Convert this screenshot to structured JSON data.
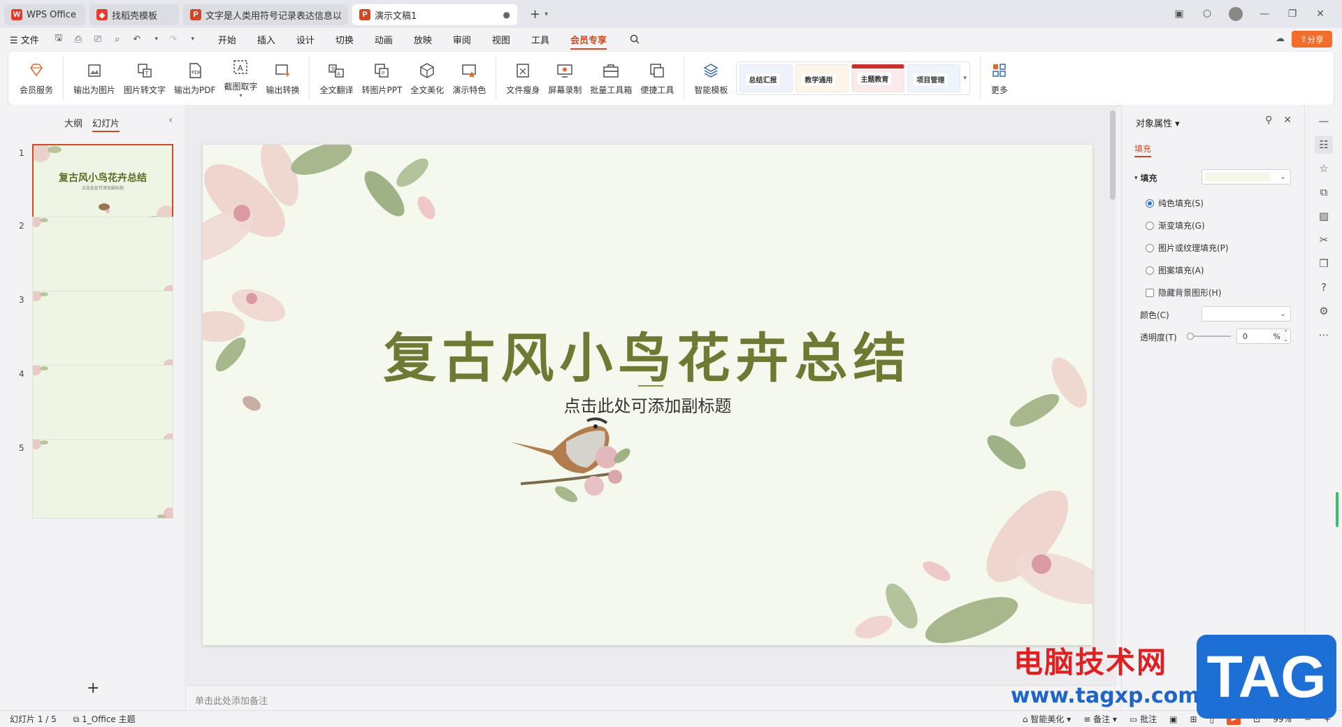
{
  "titlebar": {
    "tabs": [
      {
        "label": "WPS Office",
        "icon": "wps-logo-icon",
        "color": "#e33b2e"
      },
      {
        "label": "找稻壳模板",
        "icon": "docer-icon",
        "color": "#e33b2e"
      },
      {
        "label": "文字是人类用符号记录表达信息以传",
        "icon": "ppt-icon",
        "color": "#d24726"
      },
      {
        "label": "演示文稿1",
        "icon": "ppt-icon",
        "color": "#d24726",
        "active": true
      }
    ],
    "new_tab": "+"
  },
  "menubar": {
    "file_label": "文件",
    "items": [
      "开始",
      "插入",
      "设计",
      "切换",
      "动画",
      "放映",
      "审阅",
      "视图",
      "工具",
      "会员专享"
    ],
    "active_item": "会员专享",
    "share_label": "分享"
  },
  "ribbon": {
    "group1": [
      {
        "label": "会员服务"
      }
    ],
    "group2": [
      {
        "label": "输出为图片"
      },
      {
        "label": "图片转文字"
      },
      {
        "label": "输出为PDF"
      },
      {
        "label": "截图取字"
      },
      {
        "label": "输出转换"
      }
    ],
    "group3": [
      {
        "label": "全文翻译"
      },
      {
        "label": "转图片PPT"
      },
      {
        "label": "全文美化"
      },
      {
        "label": "演示特色"
      }
    ],
    "group4": [
      {
        "label": "文件瘦身"
      },
      {
        "label": "屏幕录制"
      },
      {
        "label": "批量工具箱"
      },
      {
        "label": "便捷工具"
      }
    ],
    "group5": [
      {
        "label": "智能模板"
      }
    ],
    "templates": [
      "总结汇报",
      "教学通用",
      "主题教育",
      "项目管理"
    ],
    "more_label": "更多"
  },
  "left_panel": {
    "tab_outline": "大纲",
    "tab_slides": "幻灯片",
    "slides": [
      {
        "num": "1",
        "title": "复古风小鸟花卉总结",
        "subtitle": "点击此处可添加副标题"
      },
      {
        "num": "2"
      },
      {
        "num": "3"
      },
      {
        "num": "4"
      },
      {
        "num": "5"
      }
    ],
    "add_label": "+"
  },
  "slide": {
    "title": "复古风小鸟花卉总结",
    "subtitle": "点击此处可添加副标题",
    "title_color": "#6e7a34"
  },
  "notes_placeholder": "单击此处添加备注",
  "properties": {
    "title": "对象属性",
    "tab": "填充",
    "section": "填充",
    "options": [
      {
        "label": "纯色填充(S)",
        "checked": true
      },
      {
        "label": "渐变填充(G)",
        "checked": false
      },
      {
        "label": "图片或纹理填充(P)",
        "checked": false
      },
      {
        "label": "图案填充(A)",
        "checked": false
      }
    ],
    "hide_bg_label": "隐藏背景图形(H)",
    "color_label": "颜色(C)",
    "transparency_label": "透明度(T)",
    "transparency_value": "0",
    "transparency_unit": "%"
  },
  "statusbar": {
    "slide_info": "幻灯片 1 / 5",
    "theme": "1_Office 主题",
    "smart_beautify": "智能美化",
    "notes": "备注",
    "comments": "批注",
    "zoom": "99%"
  },
  "watermark": {
    "line1": "电脑技术网",
    "line2": "www.tagxp.com",
    "badge": "TAG"
  }
}
